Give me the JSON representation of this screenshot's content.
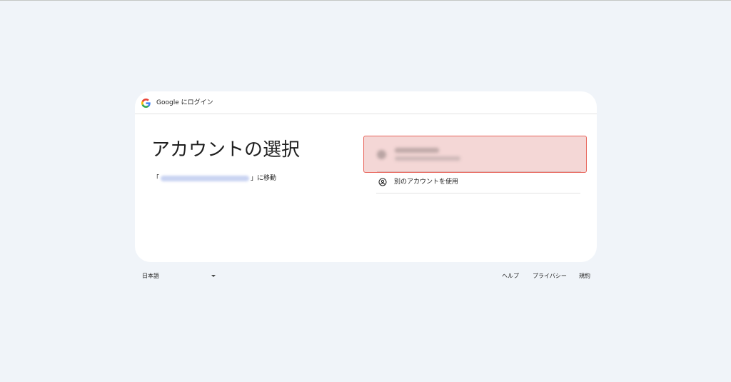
{
  "header": {
    "logo_icon": "google-g-icon",
    "title": "Google にログイン"
  },
  "main": {
    "title": "アカウントの選択",
    "continue_open": "「",
    "continue_close": "」に移動"
  },
  "accounts": {
    "other_account_icon": "person-circle-icon",
    "other_account_label": "別のアカウントを使用"
  },
  "footer": {
    "language": "日本語",
    "links": {
      "help": "ヘルプ",
      "privacy": "プライバシー",
      "terms": "規約"
    }
  },
  "colors": {
    "background": "#f0f4f9",
    "card": "#ffffff",
    "selected_fill": "#f4d7d6",
    "selected_border": "#e8655b"
  }
}
